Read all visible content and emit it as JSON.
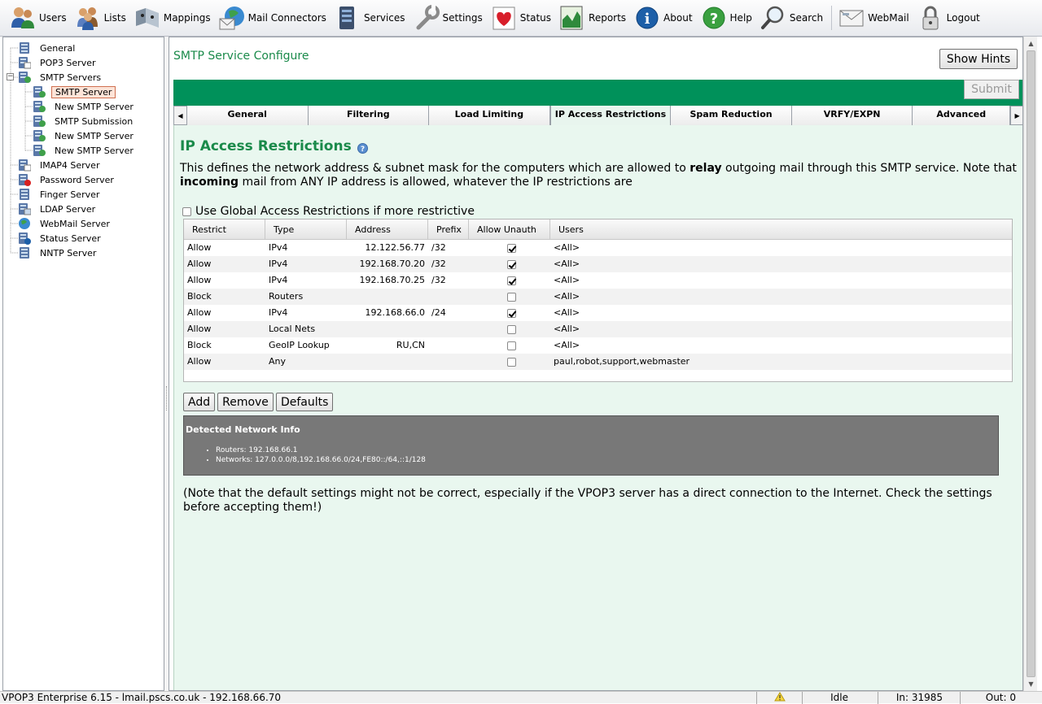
{
  "toolbar": {
    "items": [
      {
        "label": "Users",
        "icon": "users-icon"
      },
      {
        "label": "Lists",
        "icon": "lists-icon"
      },
      {
        "label": "Mappings",
        "icon": "mappings-icon"
      },
      {
        "label": "Mail Connectors",
        "icon": "mail-connectors-icon"
      },
      {
        "label": "Services",
        "icon": "services-icon"
      },
      {
        "label": "Settings",
        "icon": "settings-icon"
      },
      {
        "label": "Status",
        "icon": "status-icon"
      },
      {
        "label": "Reports",
        "icon": "reports-icon"
      },
      {
        "label": "About",
        "icon": "about-icon"
      },
      {
        "label": "Help",
        "icon": "help-icon"
      },
      {
        "label": "Search",
        "icon": "search-icon"
      },
      {
        "label": "WebMail",
        "icon": "webmail-icon"
      },
      {
        "label": "Logout",
        "icon": "logout-icon"
      }
    ]
  },
  "tree": {
    "items": [
      {
        "label": "General",
        "level": 0
      },
      {
        "label": "POP3 Server",
        "level": 0
      },
      {
        "label": "SMTP Servers",
        "level": 0,
        "expanded": true
      },
      {
        "label": "SMTP Server",
        "level": 1,
        "selected": true
      },
      {
        "label": "New SMTP Server",
        "level": 1
      },
      {
        "label": "SMTP Submission",
        "level": 1
      },
      {
        "label": "New SMTP Server",
        "level": 1
      },
      {
        "label": "New SMTP Server",
        "level": 1
      },
      {
        "label": "IMAP4 Server",
        "level": 0
      },
      {
        "label": "Password Server",
        "level": 0
      },
      {
        "label": "Finger Server",
        "level": 0
      },
      {
        "label": "LDAP Server",
        "level": 0
      },
      {
        "label": "WebMail Server",
        "level": 0
      },
      {
        "label": "Status Server",
        "level": 0
      },
      {
        "label": "NNTP Server",
        "level": 0
      }
    ]
  },
  "main": {
    "title": "SMTP Service Configure",
    "show_hints_label": "Show Hints",
    "submit_label": "Submit",
    "tabs": [
      {
        "label": "General",
        "active": false
      },
      {
        "label": "Filtering",
        "active": false
      },
      {
        "label": "Load Limiting",
        "active": false
      },
      {
        "label": "IP Access Restrictions",
        "active": true
      },
      {
        "label": "Spam Reduction",
        "active": false
      },
      {
        "label": "VRFY/EXPN",
        "active": false
      },
      {
        "label": "Advanced",
        "active": false
      }
    ],
    "section_title": "IP Access Restrictions",
    "description": {
      "part1": "This defines the network address & subnet mask for the computers which are allowed to ",
      "bold1": "relay",
      "part2": " outgoing mail through this SMTP service. Note that ",
      "bold2": "incoming",
      "part3": " mail from ANY IP address is allowed, whatever the IP restrictions are"
    },
    "global_restrictions_label": "Use Global Access Restrictions if more restrictive",
    "grid": {
      "columns": [
        "Restrict",
        "Type",
        "Address",
        "Prefix",
        "Allow Unauth",
        "Users"
      ],
      "rows": [
        {
          "restrict": "Allow",
          "type": "IPv4",
          "address": "12.122.56.77",
          "prefix": "/32",
          "allow_unauth": true,
          "users": "<All>"
        },
        {
          "restrict": "Allow",
          "type": "IPv4",
          "address": "192.168.70.20",
          "prefix": "/32",
          "allow_unauth": true,
          "users": "<All>"
        },
        {
          "restrict": "Allow",
          "type": "IPv4",
          "address": "192.168.70.25",
          "prefix": "/32",
          "allow_unauth": true,
          "users": "<All>"
        },
        {
          "restrict": "Block",
          "type": "Routers",
          "address": "",
          "prefix": "",
          "allow_unauth": false,
          "users": "<All>"
        },
        {
          "restrict": "Allow",
          "type": "IPv4",
          "address": "192.168.66.0",
          "prefix": "/24",
          "allow_unauth": true,
          "users": "<All>"
        },
        {
          "restrict": "Allow",
          "type": "Local Nets",
          "address": "",
          "prefix": "",
          "allow_unauth": false,
          "users": "<All>"
        },
        {
          "restrict": "Block",
          "type": "GeoIP Lookup",
          "address": "RU,CN",
          "prefix": "",
          "allow_unauth": false,
          "users": "<All>"
        },
        {
          "restrict": "Allow",
          "type": "Any",
          "address": "",
          "prefix": "",
          "allow_unauth": false,
          "users": "paul,robot,support,webmaster"
        }
      ]
    },
    "buttons": {
      "add": "Add",
      "remove": "Remove",
      "defaults": "Defaults"
    },
    "network_info": {
      "title": "Detected Network Info",
      "items": [
        "Routers: 192.168.66.1",
        "Networks: 127.0.0.0/8,192.168.66.0/24,FE80::/64,::1/128"
      ]
    },
    "note": "(Note that the default settings might not be correct, especially if the VPOP3 server has a direct connection to the Internet. Check the settings before accepting them!)"
  },
  "statusbar": {
    "text": "VPOP3 Enterprise 6.15 - lmail.pscs.co.uk - 192.168.66.70",
    "state": "Idle",
    "in_label": "In: 31985",
    "out_label": "Out: 0"
  },
  "colors": {
    "accent_green": "#00915a",
    "title_green": "#1a8a4a",
    "content_bg": "#e9f7ef"
  }
}
